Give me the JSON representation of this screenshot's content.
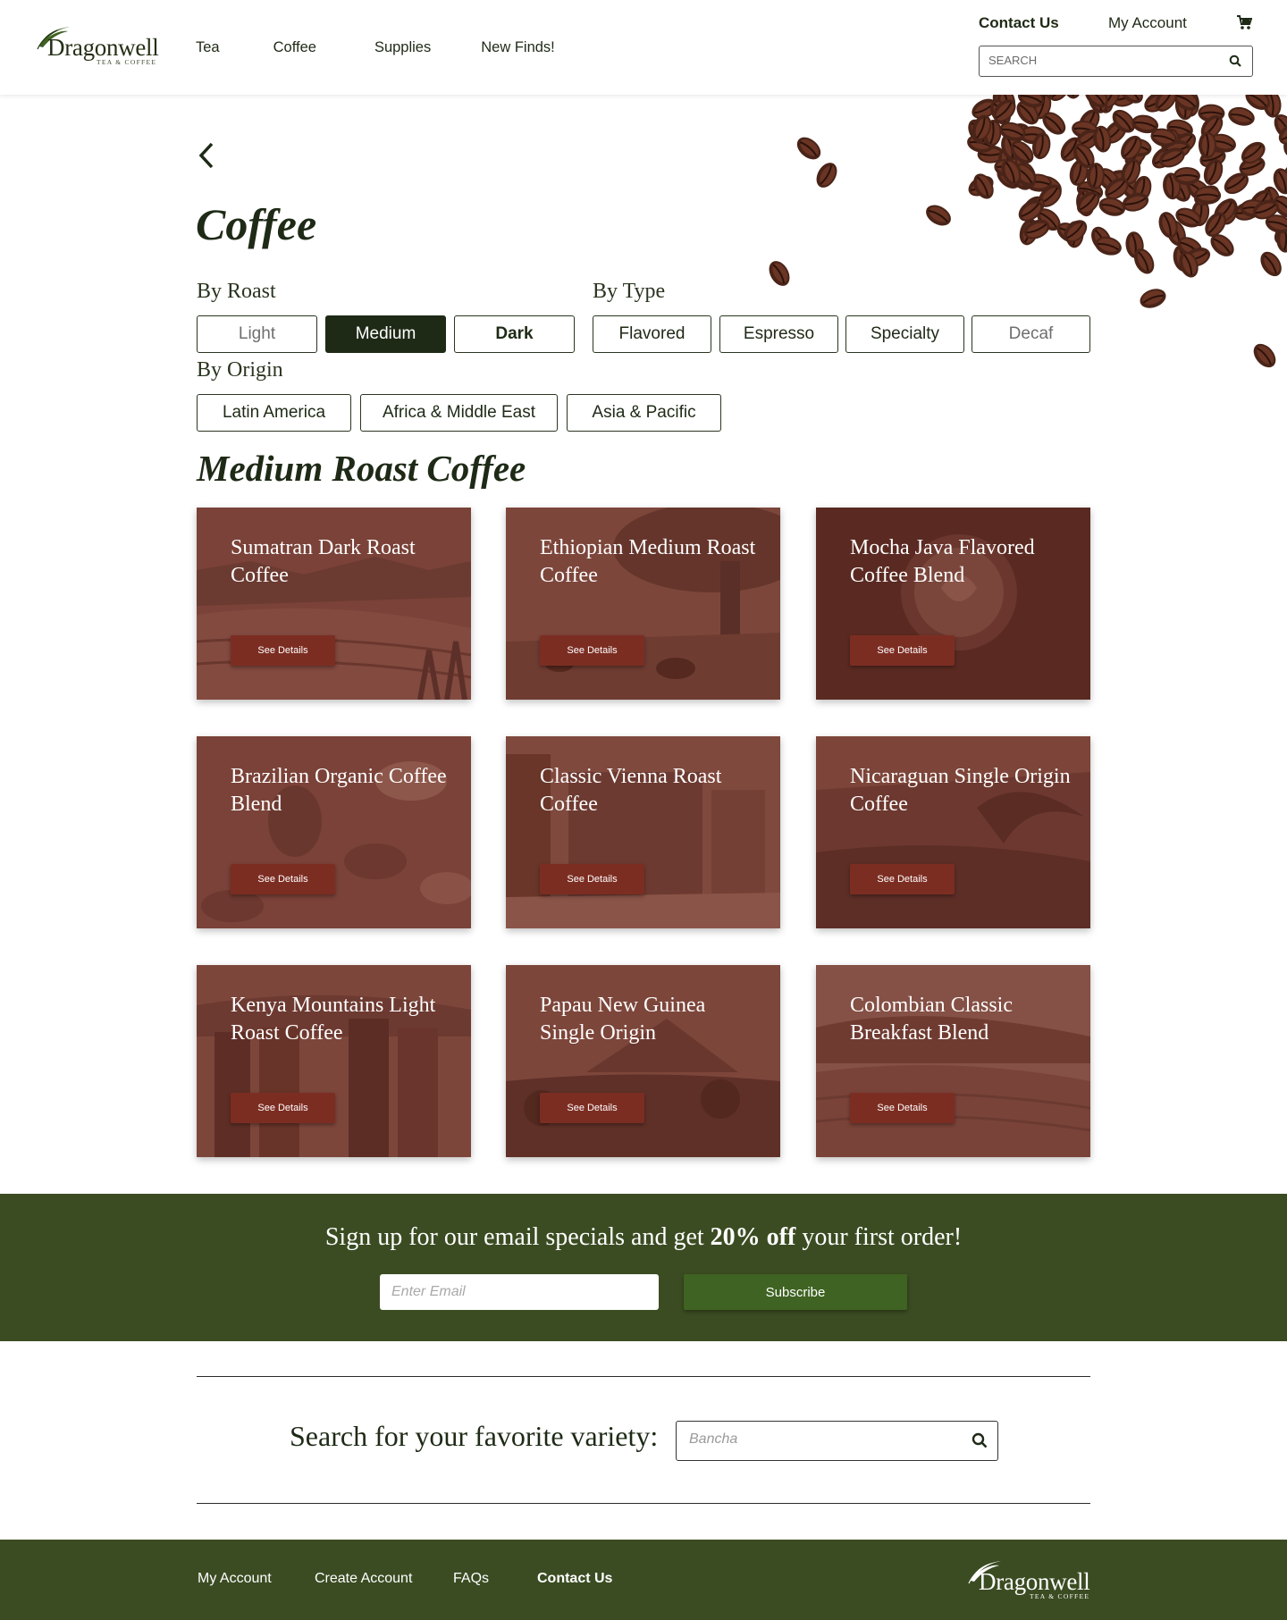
{
  "header": {
    "logo_text": "Dragonwell",
    "logo_subtext": "TEA & COFFEE",
    "nav": [
      "Tea",
      "Coffee",
      "Supplies",
      "New Finds!"
    ],
    "contact_label": "Contact Us",
    "account_label": "My Account",
    "cart_icon": "cart-icon",
    "search_placeholder": "SEARCH",
    "search_icon": "search-icon"
  },
  "page": {
    "back_icon": "chevron-left-icon",
    "title": "Coffee",
    "subtitle": "Medium Roast Coffee"
  },
  "filters": {
    "roast_label": "By Roast",
    "roast_options": [
      "Light",
      "Medium",
      "Dark"
    ],
    "roast_selected": "Medium",
    "type_label": "By Type",
    "type_options": [
      "Flavored",
      "Espresso",
      "Specialty",
      "Decaf"
    ],
    "origin_label": "By Origin",
    "origin_options": [
      "Latin America",
      "Africa & Middle East",
      "Asia & Pacific"
    ]
  },
  "products": [
    {
      "title": "Sumatran Dark Roast Coffee",
      "button": "See Details"
    },
    {
      "title": "Ethiopian Medium Roast Coffee",
      "button": "See Details"
    },
    {
      "title": "Mocha Java Flavored Coffee Blend",
      "button": "See Details"
    },
    {
      "title": "Brazilian Organic Coffee Blend",
      "button": "See Details"
    },
    {
      "title": "Classic Vienna Roast Coffee",
      "button": "See Details"
    },
    {
      "title": "Nicaraguan Single Origin Coffee",
      "button": "See Details"
    },
    {
      "title": "Kenya Mountains Light Roast Coffee",
      "button": "See Details"
    },
    {
      "title": "Papau New Guinea Single Origin",
      "button": "See Details"
    },
    {
      "title": "Colombian Classic Breakfast Blend",
      "button": "See Details"
    }
  ],
  "signup": {
    "text_before": "Sign up for our email specials and get ",
    "text_bold": "20% off",
    "text_after": " your first order!",
    "email_placeholder": "Enter Email",
    "button_label": "Subscribe"
  },
  "variety_search": {
    "label": "Search for your favorite variety:",
    "placeholder": "Bancha"
  },
  "footer": {
    "links": [
      "My Account",
      "Create Account",
      "FAQs",
      "Contact Us"
    ],
    "logo_text": "Dragonwell",
    "logo_subtext": "TEA & COFFEE"
  },
  "colors": {
    "dark_green": "#1e2a16",
    "band_green": "#3b4c22",
    "button_green": "#3f6322",
    "card_tint": "#7a3f36",
    "card_button": "#7c2d22"
  }
}
